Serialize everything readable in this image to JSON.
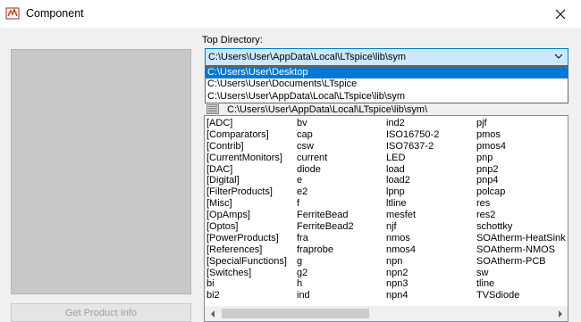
{
  "window": {
    "title": "Component",
    "close_glyph": "✕"
  },
  "left_panel": {
    "product_info_button": "Get Product Info"
  },
  "top_directory": {
    "label": "Top Directory:",
    "value": "C:\\Users\\User\\AppData\\Local\\LTspice\\lib\\sym",
    "options": [
      "C:\\Users\\User\\Desktop",
      "C:\\Users\\User\\Documents\\LTspice",
      "C:\\Users\\User\\AppData\\Local\\LTspice\\lib\\sym"
    ],
    "highlighted_index": 0
  },
  "current_path": "C:\\Users\\User\\AppData\\Local\\LTspice\\lib\\sym\\",
  "file_list": {
    "columns": [
      [
        "[ADC]",
        "[Comparators]",
        "[Contrib]",
        "[CurrentMonitors]",
        "[DAC]",
        "[Digital]",
        "[FilterProducts]",
        "[Misc]",
        "[OpAmps]",
        "[Optos]",
        "[PowerProducts]",
        "[References]",
        "[SpecialFunctions]",
        "[Switches]",
        "bi",
        "bi2"
      ],
      [
        "bv",
        "cap",
        "csw",
        "current",
        "diode",
        "e",
        "e2",
        "f",
        "FerriteBead",
        "FerriteBead2",
        "fra",
        "fraprobe",
        "g",
        "g2",
        "h",
        "ind"
      ],
      [
        "ind2",
        "ISO16750-2",
        "ISO7637-2",
        "LED",
        "load",
        "load2",
        "lpnp",
        "ltline",
        "mesfet",
        "njf",
        "nmos",
        "nmos4",
        "npn",
        "npn2",
        "npn3",
        "npn4"
      ],
      [
        "pjf",
        "pmos",
        "pmos4",
        "pnp",
        "pnp2",
        "pnp4",
        "polcap",
        "res",
        "res2",
        "schottky",
        "SOAtherm-HeatSink",
        "SOAtherm-NMOS",
        "SOAtherm-PCB",
        "sw",
        "tline",
        "TVSdiode"
      ]
    ]
  },
  "icons": {
    "app": "ltspice-component-icon",
    "close": "close-icon",
    "combo_arrow": "chevron-down-icon",
    "path": "folder-path-icon",
    "scroll_left": "scroll-left-arrow-icon",
    "scroll_right": "scroll-right-arrow-icon"
  },
  "colors": {
    "combo_bg": "#cce8ff",
    "combo_border": "#0078d7",
    "selection": "#0078d7",
    "preview_bg": "#c8c8c8"
  }
}
